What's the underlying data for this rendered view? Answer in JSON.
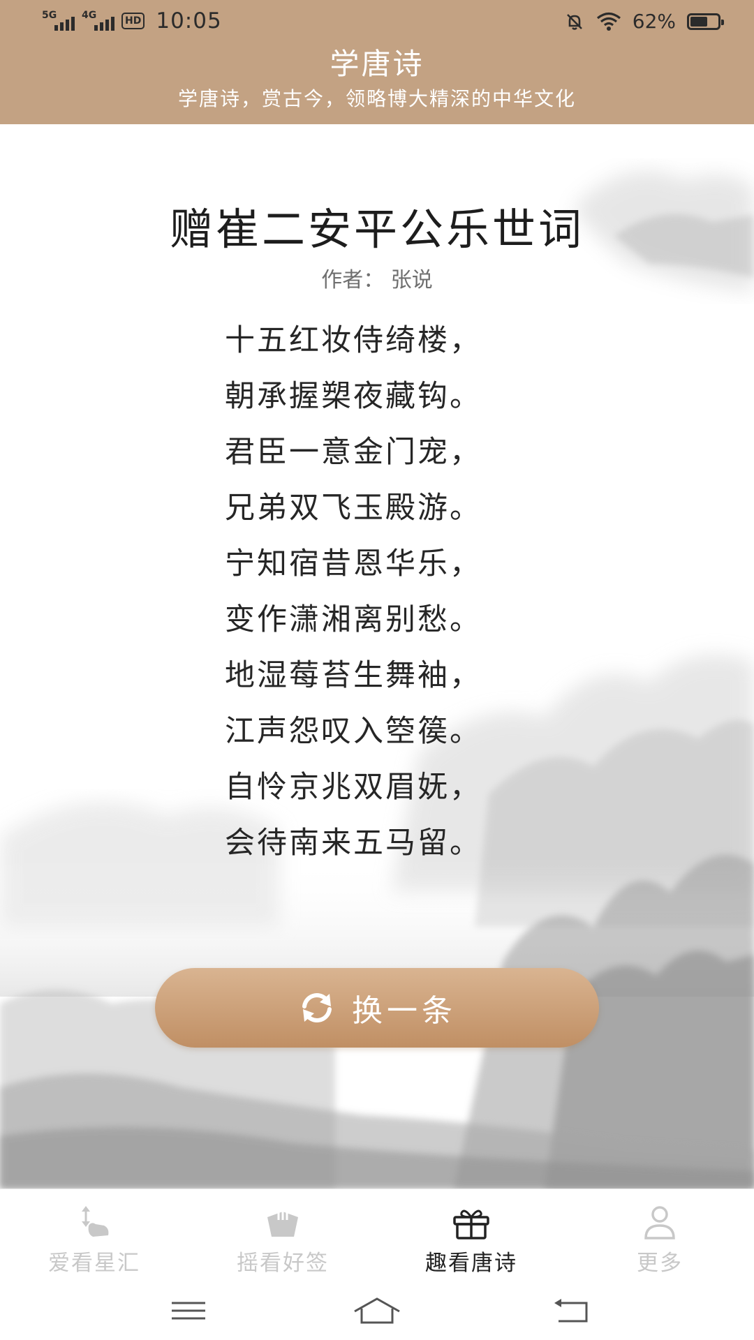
{
  "status_bar": {
    "net1": "5G",
    "net2": "4G",
    "hd": "HD",
    "time": "10:05",
    "battery_percent_text": "62%",
    "battery_level": 0.62
  },
  "header": {
    "title": "学唐诗",
    "subtitle": "学唐诗，赏古今，领略博大精深的中华文化"
  },
  "poem": {
    "title": "赠崔二安平公乐世词",
    "author_line": "作者： 张说",
    "lines": [
      "十五红妆侍绮楼，",
      "朝承握槊夜藏钩。",
      "君臣一意金门宠，",
      "兄弟双飞玉殿游。",
      "宁知宿昔恩华乐，",
      "变作潇湘离别愁。",
      "地湿莓苔生舞袖，",
      "江声怨叹入箜篌。",
      "自怜京兆双眉妩，",
      "会待南来五马留。"
    ]
  },
  "refresh_button": {
    "label": "换一条",
    "icon": "refresh-icon"
  },
  "tabbar": {
    "tabs": [
      {
        "label": "爱看星汇",
        "icon": "hand-swipe-icon",
        "active": false
      },
      {
        "label": "摇看好签",
        "icon": "fortune-sticks-icon",
        "active": false
      },
      {
        "label": "趣看唐诗",
        "icon": "gift-box-icon",
        "active": true
      },
      {
        "label": "更多",
        "icon": "user-icon",
        "active": false
      }
    ]
  },
  "colors": {
    "header_bg": "#c3a283",
    "button_gradient_top": "#d9b491",
    "button_gradient_bottom": "#c08f64",
    "tab_active": "#222222",
    "tab_inactive": "#c8c8c8"
  }
}
